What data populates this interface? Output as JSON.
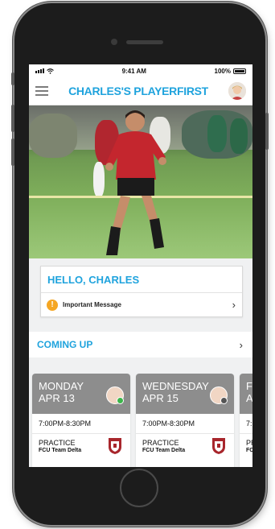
{
  "status_bar": {
    "time": "9:41 AM",
    "battery": "100%"
  },
  "header": {
    "title": "CHARLES'S PLAYERFIRST"
  },
  "greeting": {
    "title": "HELLO, CHARLES",
    "message": "Important Message",
    "message_icon": "!"
  },
  "coming_up": {
    "title": "COMING UP"
  },
  "events": [
    {
      "day": "MONDAY",
      "date": "APR 13",
      "time": "7:00PM-8:30PM",
      "type": "PRACTICE",
      "team": "FCU Team Delta",
      "status_color": "#3cb54a"
    },
    {
      "day": "WEDNESDAY",
      "date": "APR 15",
      "time": "7:00PM-8:30PM",
      "type": "PRACTICE",
      "team": "FCU Team Delta",
      "status_color": "#555555"
    },
    {
      "day": "F",
      "date": "A",
      "time": "7:",
      "type": "PR",
      "team": "FC",
      "status_color": "#555555"
    }
  ],
  "colors": {
    "accent": "#1fa3dd",
    "warning": "#f5a623",
    "card_header": "#8d8d8d"
  },
  "icons": [
    "menu-icon",
    "avatar",
    "warning-icon",
    "chevron-right-icon",
    "team-crest-icon"
  ]
}
